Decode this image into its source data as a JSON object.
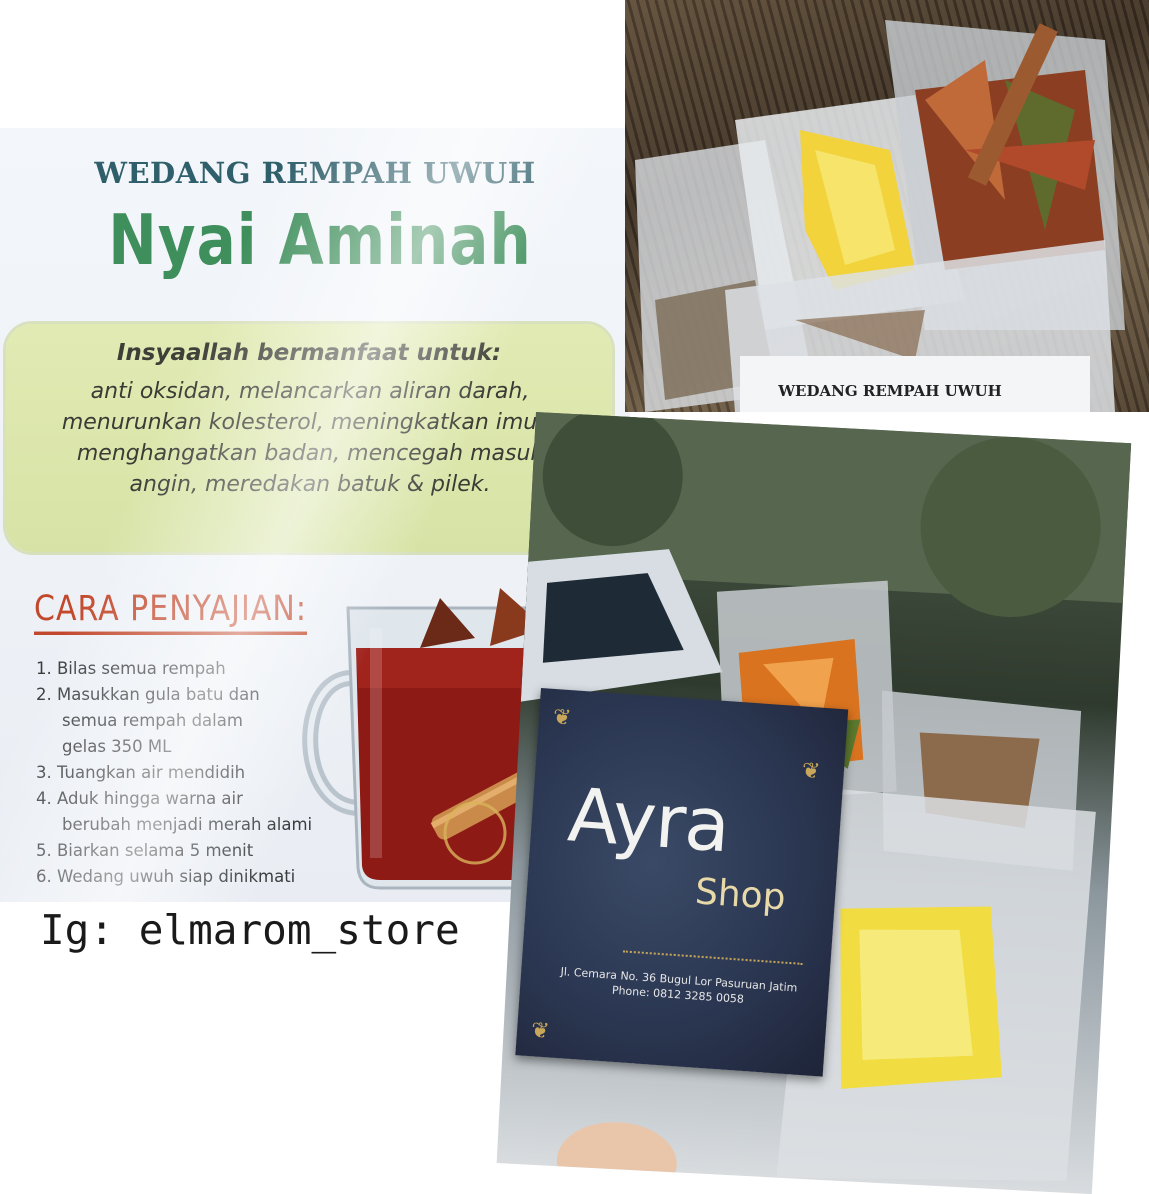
{
  "label": {
    "subtitle": "WEDANG REMPAH UWUH",
    "brand": "Nyai Aminah",
    "benefit_title": "Insyaallah bermanfaat untuk:",
    "benefit_text": "anti oksidan, melancarkan aliran darah,\nmenurunkan kolesterol, meningkatkan imun,\nmenghangatkan badan, mencegah masuk\nangin, meredakan batuk & pilek.",
    "serve_title": "CARA PENYAJIAN:",
    "steps": [
      {
        "line1": "1. Bilas semua rempah",
        "line2": ""
      },
      {
        "line1": "2. Masukkan gula batu dan",
        "line2": "semua rempah dalam"
      },
      {
        "line1": "",
        "line2": "gelas 350 ML"
      },
      {
        "line1": "3. Tuangkan air mendidih",
        "line2": ""
      },
      {
        "line1": "4. Aduk hingga warna air",
        "line2": "berubah menjadi merah alami"
      },
      {
        "line1": "5. Biarkan selama 5 menit",
        "line2": ""
      },
      {
        "line1": "6. Wedang uwuh siap dinikmati",
        "line2": ""
      }
    ]
  },
  "instagram_caption": "Ig: elmarom_store",
  "top_photo": {
    "bag_label": "WEDANG REMPAH UWUH"
  },
  "business_card": {
    "logo_main": "Ayra",
    "logo_sub": "Shop",
    "address": "Jl. Cemara No. 36 Bugul Lor Pasuruan Jatim",
    "phone": "Phone: 0812 3285 0058"
  },
  "colors": {
    "brand_green": "#3f8f5c",
    "subtitle_teal": "#2f5f6a",
    "serve_red": "#c2482c",
    "benefit_box": "#dbe6ab",
    "card_navy": "#2b3752",
    "card_gold": "#c8a75a"
  }
}
